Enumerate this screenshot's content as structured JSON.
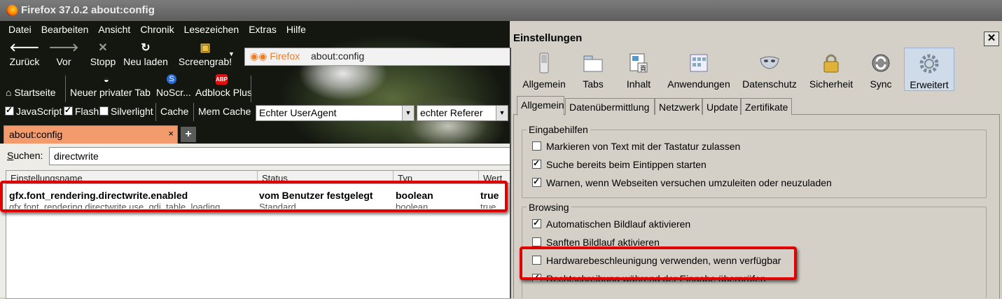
{
  "window": {
    "title": "Firefox 37.0.2 about:config"
  },
  "menu": [
    "Datei",
    "Bearbeiten",
    "Ansicht",
    "Chronik",
    "Lesezeichen",
    "Extras",
    "Hilfe"
  ],
  "toolbar": {
    "back": "Zurück",
    "forward": "Vor",
    "stop": "Stopp",
    "reload": "Neu laden",
    "screengrab": "Screengrab!"
  },
  "urlbar": {
    "identity": "Firefox",
    "url": "about:config"
  },
  "bookmarks": {
    "home": "Startseite",
    "private": "Neuer privater Tab",
    "noscript": "NoScr...",
    "adblock": "Adblock Plus",
    "abp_badge": "ABP"
  },
  "options": {
    "javascript": "JavaScript",
    "flash": "Flash",
    "silverlight": "Silverlight",
    "cache": "Cache",
    "memcache": "Mem Cache",
    "useragent": "Echter UserAgent",
    "referer": "echter Referer"
  },
  "tab": {
    "title": "about:config",
    "close": "×",
    "new": "+"
  },
  "config": {
    "search_label": "Suchen:",
    "search_value": "directwrite",
    "columns": [
      "Einstellungsname",
      "Status",
      "Typ",
      "Wert"
    ],
    "rows": [
      [
        "gfx.font_rendering.directwrite.enabled",
        "vom Benutzer festgelegt",
        "boolean",
        "true"
      ],
      [
        "gfx.font_rendering.directwrite.use_gdi_table_loading",
        "Standard",
        "boolean",
        "true"
      ]
    ]
  },
  "dialog": {
    "title": "Einstellungen",
    "close": "✕",
    "panes": [
      "Allgemein",
      "Tabs",
      "Inhalt",
      "Anwendungen",
      "Datenschutz",
      "Sicherheit",
      "Sync",
      "Erweitert"
    ],
    "tabs": [
      "Allgemein",
      "Datenübermittlung",
      "Netzwerk",
      "Update",
      "Zertifikate"
    ],
    "group1": {
      "label": "Eingabehilfen",
      "items": [
        "Markieren von Text mit der Tastatur zulassen",
        "Suche bereits beim Eintippen starten",
        "Warnen, wenn Webseiten versuchen umzuleiten oder neuzuladen"
      ],
      "checked": [
        false,
        true,
        true
      ]
    },
    "group2": {
      "label": "Browsing",
      "items": [
        "Automatischen Bildlauf aktivieren",
        "Sanften Bildlauf aktivieren",
        "Hardwarebeschleunigung verwenden, wenn verfügbar",
        "Rechtschreibung während der Eingabe überprüfen"
      ],
      "checked": [
        true,
        false,
        false,
        true
      ]
    }
  }
}
